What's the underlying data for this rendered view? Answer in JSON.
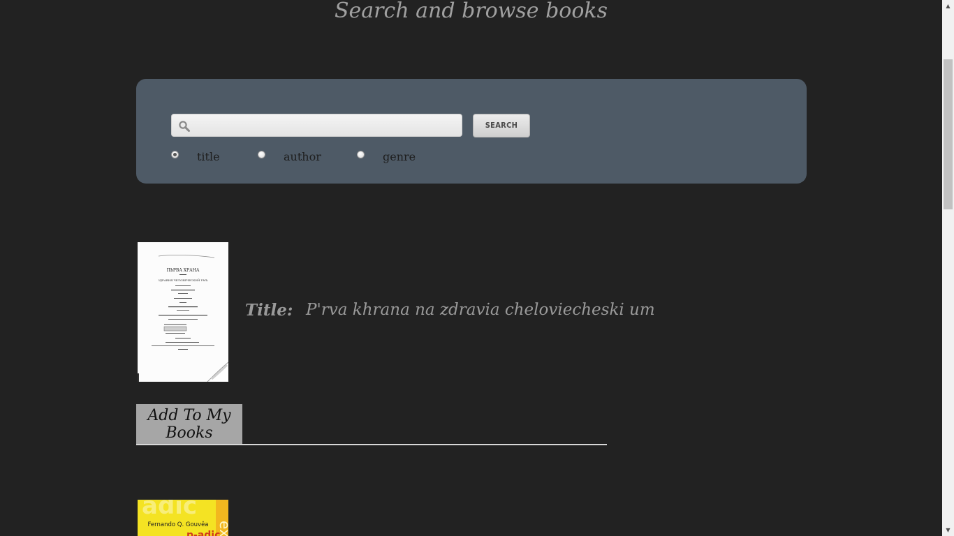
{
  "header": {
    "title": "Search and browse books"
  },
  "search": {
    "placeholder": "",
    "value": "",
    "button_label": "Search",
    "options": [
      {
        "label": "title",
        "checked": true
      },
      {
        "label": "author",
        "checked": false
      },
      {
        "label": "genre",
        "checked": false
      }
    ]
  },
  "results": [
    {
      "title_label": "Title:",
      "title": "P'rva khrana na zdravia cheloviecheski um",
      "cover_text": [
        "ПЬРВА ХРАНА",
        "ЗДРАВИЯ ЧЕЛОВЕЧЕСКИЙ УМЪ"
      ],
      "add_label": "Add To My Books"
    },
    {
      "cover_author": "Fernando Q. Gouvêa"
    }
  ],
  "scrollbar": {
    "up_icon": "triangle-up-icon",
    "down_icon": "triangle-down-icon"
  }
}
